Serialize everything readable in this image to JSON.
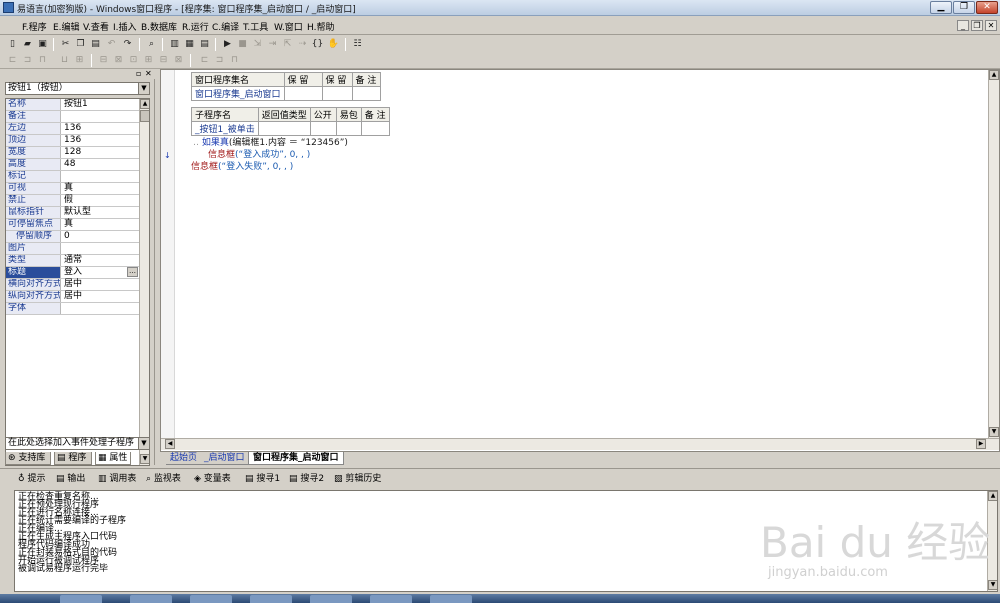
{
  "window": {
    "title": "易语言(加密狗版) - Windows窗口程序 - [程序集: 窗口程序集_启动窗口 / _启动窗口]",
    "controls": [
      "minimize",
      "restore",
      "close"
    ]
  },
  "menu": {
    "items": [
      "F.程序",
      "E.编辑",
      "V.查看",
      "I.插入",
      "B.数据库",
      "R.运行",
      "C.编译",
      "T.工具",
      "W.窗口",
      "H.帮助"
    ]
  },
  "properties_panel": {
    "combo": "按钮1（按钮）",
    "rows": [
      {
        "key": "名称",
        "value": "按钮1"
      },
      {
        "key": "备注",
        "value": ""
      },
      {
        "key": "左边",
        "value": "136"
      },
      {
        "key": "顶边",
        "value": "136"
      },
      {
        "key": "宽度",
        "value": "128"
      },
      {
        "key": "高度",
        "value": "48"
      },
      {
        "key": "标记",
        "value": ""
      },
      {
        "key": "可视",
        "value": "真"
      },
      {
        "key": "禁止",
        "value": "假"
      },
      {
        "key": "鼠标指针",
        "value": "默认型"
      },
      {
        "key": "可停留焦点",
        "value": "真"
      },
      {
        "key": "停留顺序",
        "value": "0"
      },
      {
        "key": "图片",
        "value": ""
      },
      {
        "key": "类型",
        "value": "通常"
      },
      {
        "key": "标题",
        "value": "登入"
      },
      {
        "key": "横向对齐方式",
        "value": "居中"
      },
      {
        "key": "纵向对齐方式",
        "value": "居中"
      },
      {
        "key": "字体",
        "value": ""
      }
    ],
    "selected_row": "标题",
    "event_combo": "在此处选择加入事件处理子程序",
    "tabs": [
      "支持库",
      "程序",
      "属性"
    ],
    "active_tab": "属性"
  },
  "editor": {
    "table1": {
      "headers": [
        "窗口程序集名",
        "保 留",
        "保 留",
        "备 注"
      ],
      "row": [
        "窗口程序集_启动窗口",
        "",
        "",
        ""
      ]
    },
    "table2": {
      "headers": [
        "子程序名",
        "返回值类型",
        "公开",
        "易包",
        "备 注"
      ],
      "row": [
        "_按钮1_被单击",
        "",
        "",
        "",
        ""
      ]
    },
    "code_lines": [
      {
        "keyword": "如果真",
        "text": "(编辑框1.内容 ＝ “123456”)"
      },
      {
        "keyword": "信息框",
        "text": "(“登入成功”, 0, , )"
      },
      {
        "keyword": "信息框",
        "text": "(“登入失败”, 0, , )"
      }
    ]
  },
  "doc_tabs": [
    "起始页",
    "_启动窗口",
    "窗口程序集_启动窗口"
  ],
  "active_doc_tab": "窗口程序集_启动窗口",
  "bottom_panel": {
    "tabs": [
      "提示",
      "输出",
      "调用表",
      "监视表",
      "变量表",
      "搜寻1",
      "搜寻2",
      "剪辑历史"
    ],
    "output_lines": [
      "正在检查重复名称...",
      "正在预处理现行程序",
      "正在进行名称连接...",
      "正在统计需要编译的子程序",
      "正在编译...",
      "正在生成主程序入口代码",
      "程序代码编译成功",
      "正在封装易格式目的代码",
      "开始运行被调试程序",
      "被调试易程序运行完毕"
    ]
  },
  "watermark": {
    "brand": "Bai du 经验",
    "url": "jingyan.baidu.com"
  },
  "icons": [
    "new-icon",
    "open-icon",
    "save-icon",
    "cut-icon",
    "copy-icon",
    "paste-icon",
    "undo-icon",
    "redo-icon",
    "find-icon",
    "run-icon",
    "stop-icon",
    "step-icon",
    "breakpoint-icon",
    "hand-icon"
  ]
}
